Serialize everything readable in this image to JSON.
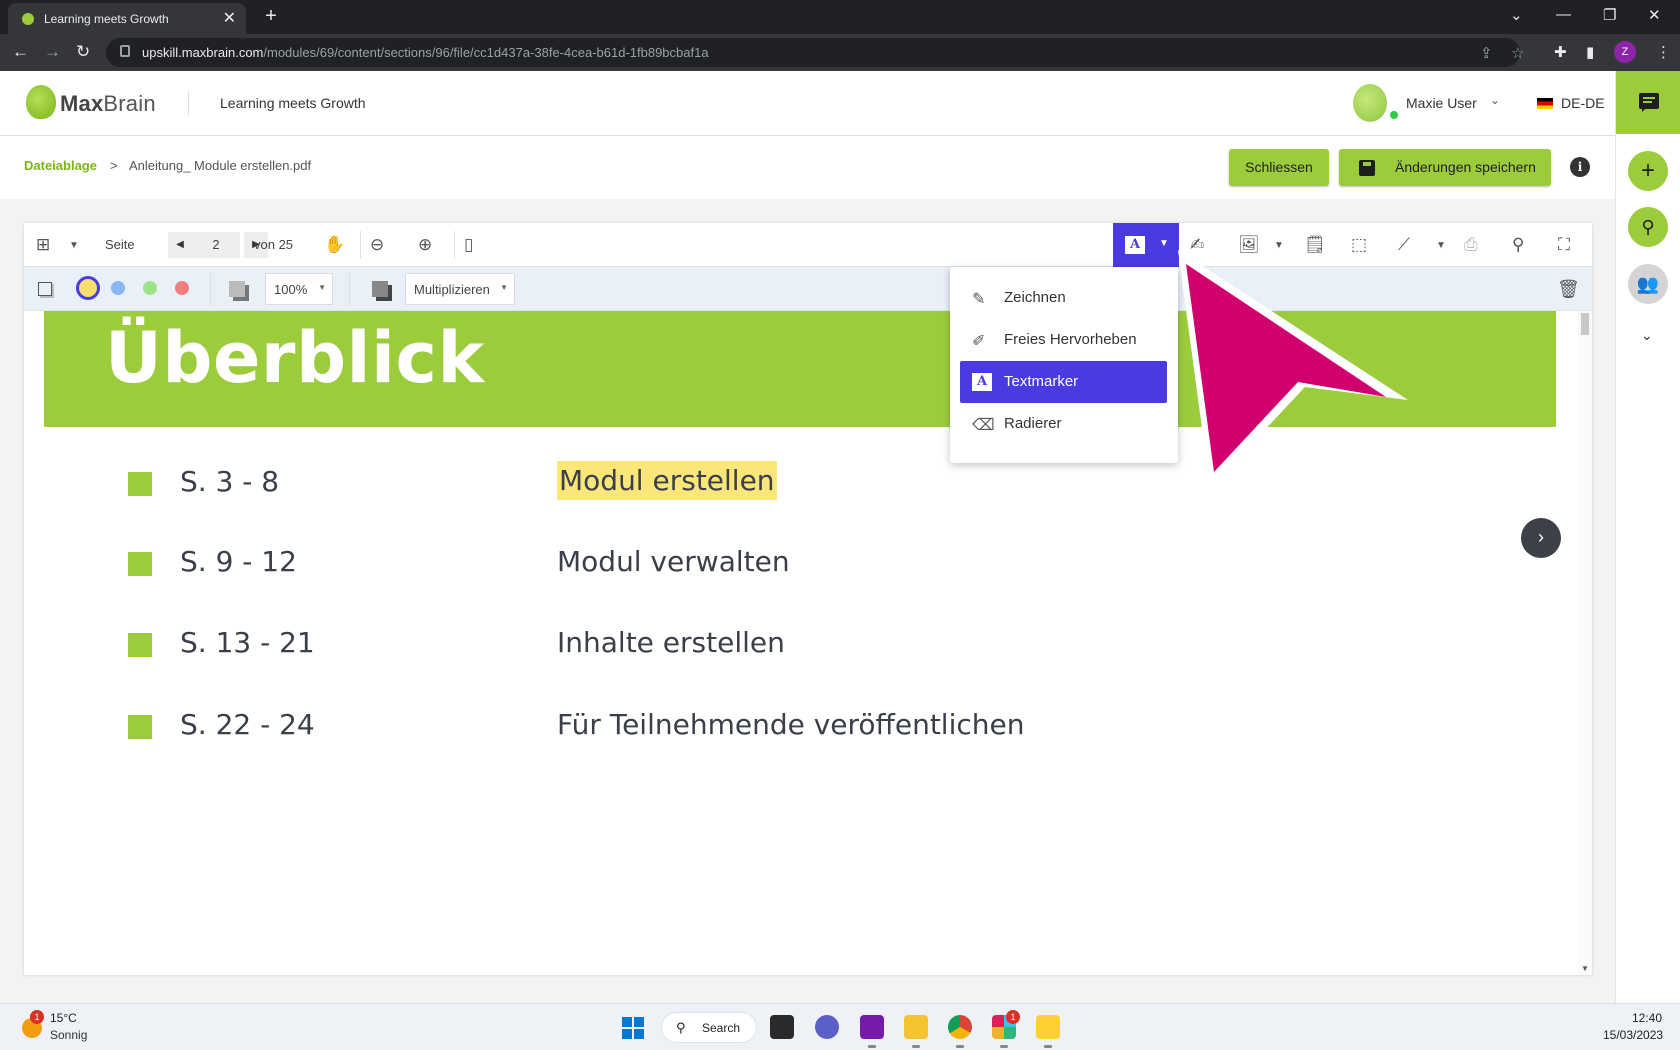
{
  "browser": {
    "tab_title": "Learning meets Growth",
    "tab_close": "✕",
    "new_tab": "+",
    "url_host": "upskill.maxbrain.com",
    "url_path": "/modules/69/content/sections/96/file/cc1d437a-38fe-4cea-b61d-1fb89bcbaf1a",
    "profile_initial": "Z"
  },
  "header": {
    "logo_bold": "Max",
    "logo_light": "Brain",
    "tagline": "Learning meets Growth",
    "user_name": "Maxie User",
    "language": "DE-DE"
  },
  "breadcrumb": {
    "root": "Dateiablage",
    "separator": ">",
    "file": "Anleitung_ Module erstellen.pdf"
  },
  "actions": {
    "close_label": "Schliessen",
    "save_label": "Änderungen speichern",
    "info_label": "i"
  },
  "toolbar": {
    "page_label": "Seite",
    "current_page": "2",
    "page_of": "von 25"
  },
  "subbar": {
    "zoom_value": "100%",
    "blend_mode": "Multiplizieren",
    "highlight_color": "#f7dc6f",
    "swatch_colors": [
      "#f7dc6f",
      "#8bb5f0",
      "#9de38a",
      "#f08080"
    ]
  },
  "tool_dropdown": {
    "items": [
      {
        "label": "Zeichnen",
        "icon": "pen-icon"
      },
      {
        "label": "Freies Hervorheben",
        "icon": "highlighter-icon"
      },
      {
        "label": "Textmarker",
        "icon": "text-highlight-icon",
        "active": true
      },
      {
        "label": "Radierer",
        "icon": "eraser-icon"
      }
    ]
  },
  "document": {
    "title": "Überblick",
    "toc": [
      {
        "pages": "S. 3 - 8",
        "title": "Modul erstellen",
        "highlighted": true
      },
      {
        "pages": "S. 9 - 12",
        "title": "Modul verwalten"
      },
      {
        "pages": "S. 13 - 21",
        "title": "Inhalte erstellen"
      },
      {
        "pages": "S. 22 - 24",
        "title": "Für Teilnehmende veröffentlichen"
      }
    ]
  },
  "taskbar": {
    "weather_temp": "15°C",
    "weather_desc": "Sonnig",
    "weather_badge": "1",
    "search_label": "Search",
    "slack_badge": "1",
    "time": "12:40",
    "date": "15/03/2023"
  },
  "colors": {
    "brand_green": "#9ccc3c",
    "tool_active": "#4a3be0",
    "annotation_arrow": "#d0006f"
  }
}
